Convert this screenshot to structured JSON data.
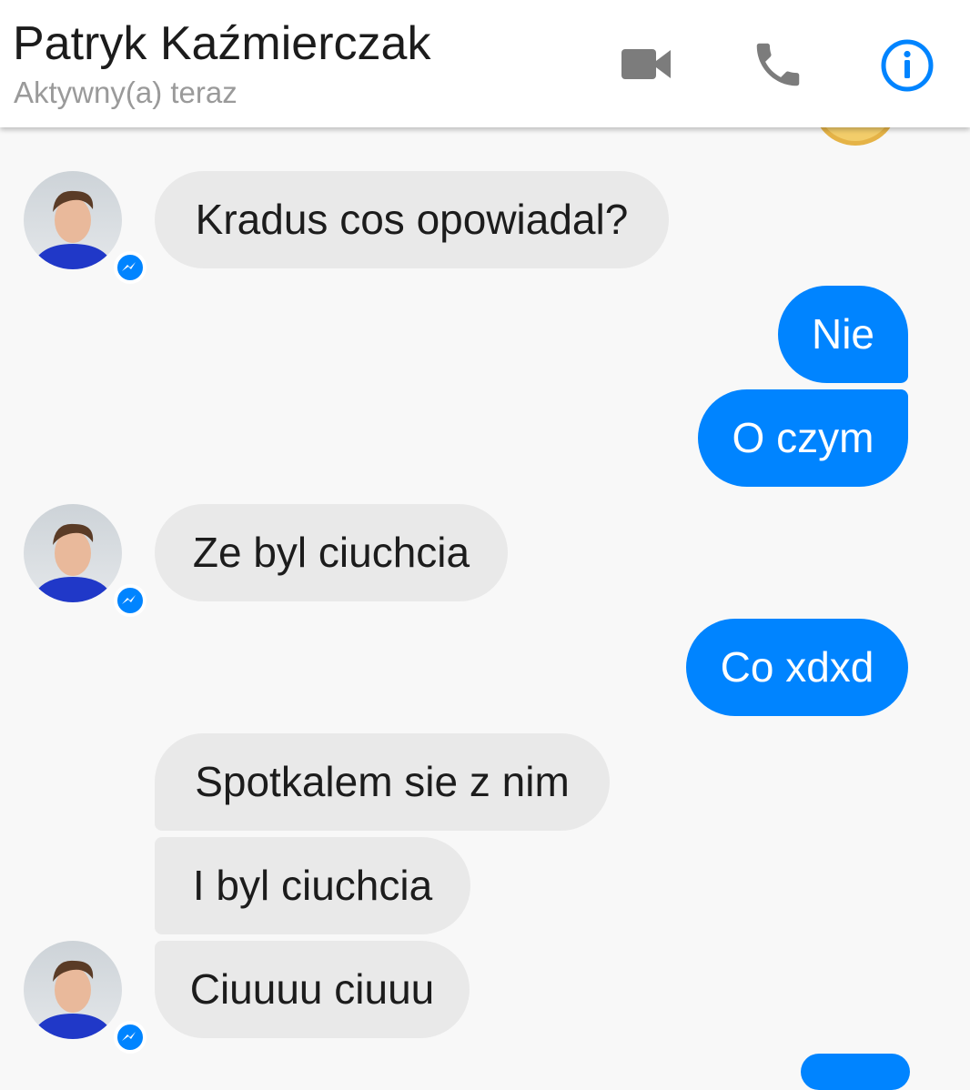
{
  "header": {
    "contact_name": "Patryk Kaźmierczak",
    "status": "Aktywny(a) teraz",
    "icons": [
      "video-camera-icon",
      "phone-icon",
      "info-icon"
    ],
    "accent_color": "#0084ff",
    "icon_gray": "#7c7c7c"
  },
  "messages": [
    {
      "sender": "contact",
      "text": "Kradus cos opowiadal?"
    },
    {
      "sender": "me",
      "text": "Nie"
    },
    {
      "sender": "me",
      "text": "O czym"
    },
    {
      "sender": "contact",
      "text": "Ze byl ciuchcia"
    },
    {
      "sender": "me",
      "text": "Co xdxd"
    },
    {
      "sender": "contact",
      "text": "Spotkalem sie z nim"
    },
    {
      "sender": "contact",
      "text": "I byl ciuchcia"
    },
    {
      "sender": "contact",
      "text": "Ciuuuu ciuuu"
    }
  ],
  "colors": {
    "incoming_bubble": "#e9e9e9",
    "outgoing_bubble": "#0084ff",
    "background": "#f8f8f8"
  }
}
